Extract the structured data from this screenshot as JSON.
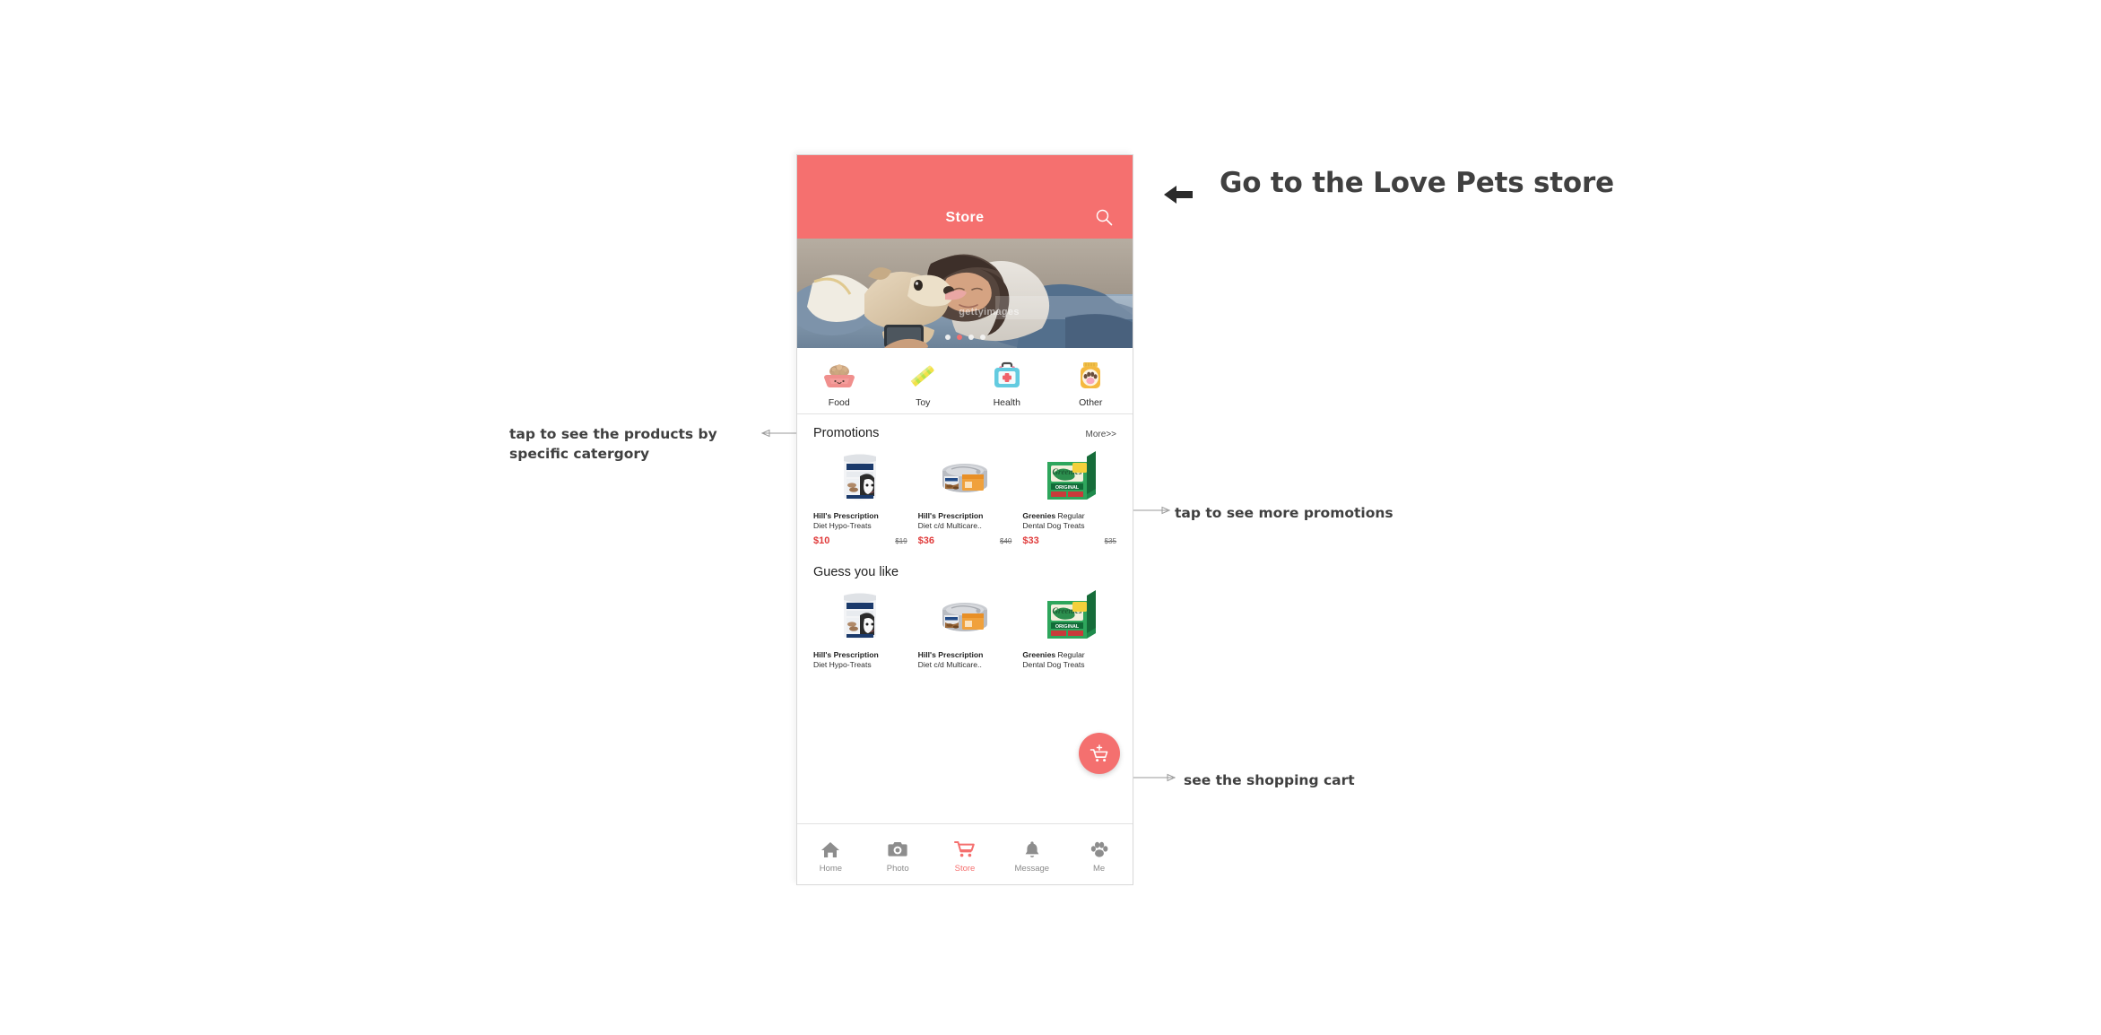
{
  "annotations": {
    "main": "Go to the Love Pets store",
    "category": "tap to see the products by specific catergory",
    "promotions": "tap to see more promotions",
    "cart": "see the shopping cart"
  },
  "phone": {
    "header": {
      "title": "Store",
      "search_icon": "search-icon"
    },
    "hero": {
      "watermark": "gettyimages",
      "dot_count": 4,
      "active_dot": 2
    },
    "categories": [
      {
        "label": "Food",
        "icon": "food-bowl-icon"
      },
      {
        "label": "Toy",
        "icon": "toy-stick-icon"
      },
      {
        "label": "Health",
        "icon": "first-aid-kit-icon"
      },
      {
        "label": "Other",
        "icon": "paw-jar-icon"
      }
    ],
    "promotions": {
      "title": "Promotions",
      "more_label": "More>>",
      "products": [
        {
          "brand": "Hill's Prescription",
          "name": "Diet Hypo-Treats",
          "price": "$10",
          "original_price": "$19",
          "image": "hills-treats-pouch"
        },
        {
          "brand": "Hill's Prescription",
          "name": "Diet c/d Multicare..",
          "price": "$36",
          "original_price": "$40",
          "image": "hills-wet-can"
        },
        {
          "brand": "Greenies",
          "name_suffix": " Regular",
          "name": "Dental Dog Treats",
          "price": "$33",
          "original_price": "$35",
          "image": "greenies-box"
        }
      ]
    },
    "guess_you_like": {
      "title": "Guess you like",
      "products": [
        {
          "brand": "Hill's Prescription",
          "name": "Diet Hypo-Treats",
          "image": "hills-treats-pouch"
        },
        {
          "brand": "Hill's Prescription",
          "name": "Diet c/d Multicare..",
          "image": "hills-wet-can"
        },
        {
          "brand": "Greenies",
          "name_suffix": " Regular",
          "name": "Dental Dog Treats",
          "image": "greenies-box"
        }
      ]
    },
    "fab": {
      "icon": "add-to-cart-icon"
    },
    "bottom_nav": [
      {
        "label": "Home",
        "icon": "home-icon",
        "active": false
      },
      {
        "label": "Photo",
        "icon": "camera-icon",
        "active": false
      },
      {
        "label": "Store",
        "icon": "cart-icon",
        "active": true
      },
      {
        "label": "Message",
        "icon": "bell-icon",
        "active": false
      },
      {
        "label": "Me",
        "icon": "paw-icon",
        "active": false
      }
    ]
  },
  "colors": {
    "brand": "#f5706f",
    "price": "#e03a3a",
    "annotation": "#404040"
  }
}
